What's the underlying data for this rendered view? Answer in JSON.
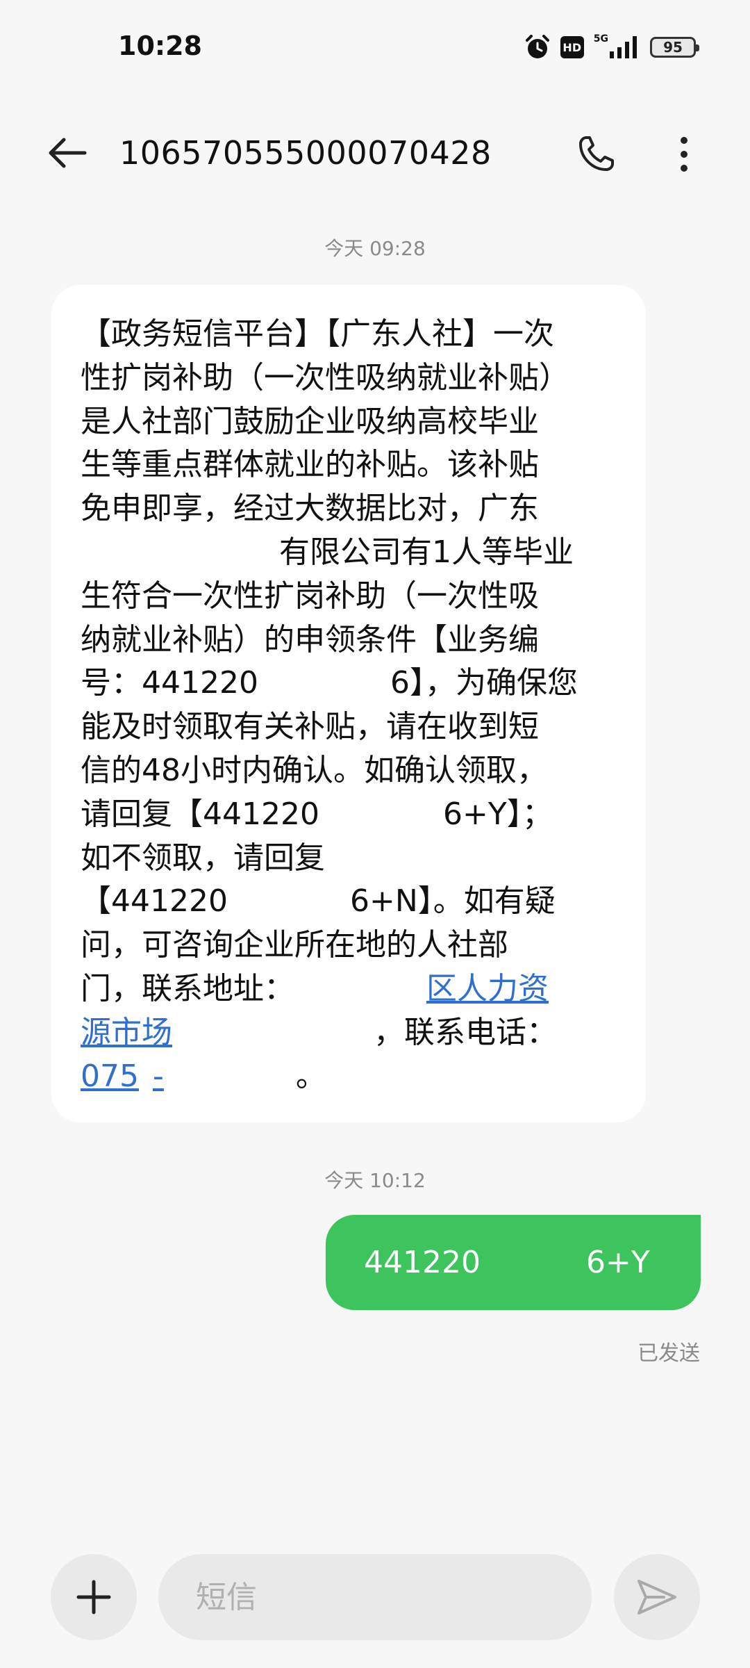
{
  "status_bar": {
    "time": "10:28",
    "network_label": "5G",
    "hd_label": "HD",
    "battery": "95",
    "icons": [
      "alarm-icon",
      "hd-icon",
      "signal-icon",
      "battery-icon"
    ]
  },
  "header": {
    "title": "10657055500007042​8",
    "icons": {
      "back": "arrow-left-icon",
      "call": "phone-icon",
      "more": "more-vertical-icon"
    }
  },
  "conversation": {
    "timestamps": [
      "今天 09:28",
      "今天 10:12"
    ],
    "incoming_message": {
      "lines": [
        "【政务短信平台】【广东人社】一次",
        "性扩岗补助（一次性吸纳就业补贴）",
        "是人社部门鼓励企业吸纳高校毕业",
        "生等重点群体就业的补贴。该补贴",
        "免申即享，经过大数据比对，广东",
        "有限公司有1人等毕业",
        "生符合一次性扩岗补助（一次性吸",
        "纳就业补贴）的申领条件【业务编",
        "号：441220",
        "6】，为确保您",
        "能及时领取有关补贴，请在收到短",
        "信的48小时内确认。如确认领取，",
        "请回复【441220",
        "6+Y】；",
        "如不领取，请回复",
        "【441220",
        "6+N】。如有疑",
        "问，可咨询企业所在地的人社部",
        "门，联系地址：",
        "区人力资",
        "源市场",
        "，联系电话：",
        "075",
        "-",
        "。"
      ]
    },
    "outgoing_message": {
      "part1": "441220",
      "part2": "6+Y",
      "status": "已发送"
    }
  },
  "composer": {
    "placeholder": "短信",
    "icons": {
      "add": "plus-icon",
      "send": "send-icon"
    }
  },
  "colors": {
    "background": "#f7f7f7",
    "incoming_bubble": "#ffffff",
    "outgoing_bubble": "#3ec45c",
    "link": "#2f6fd0"
  }
}
